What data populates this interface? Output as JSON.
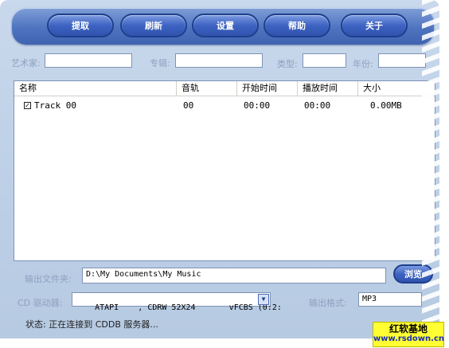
{
  "toolbar": {
    "buttons": [
      {
        "label": "提取"
      },
      {
        "label": "刷新"
      },
      {
        "label": "设置"
      },
      {
        "label": "帮助"
      },
      {
        "label": "关于"
      }
    ]
  },
  "info": {
    "artist_label": "艺术家:",
    "artist_value": "",
    "album_label": "专辑:",
    "album_value": "",
    "genre_label": "类型:",
    "genre_value": "",
    "year_label": "年份:",
    "year_value": ""
  },
  "tracklist": {
    "columns": [
      "名称",
      "音轨",
      "开始时间",
      "播放时间",
      "大小"
    ],
    "rows": [
      {
        "checked": true,
        "name": "Track 00",
        "track": "00",
        "start": "00:00",
        "duration": "00:00",
        "size": "0.00MB"
      }
    ]
  },
  "output": {
    "folder_label": "输出文件夹:",
    "folder_value": "D:\\My Documents\\My Music",
    "browse_label": "浏览",
    "drive_label": "CD 驱动器:",
    "drive_value": "ATAPI    , CDRW 52X24       vFCBS (0:2:",
    "format_label": "输出格式:",
    "format_value": "MP3"
  },
  "status": {
    "label": "状态:",
    "text": "正在连接到 CDDB 服务器..."
  },
  "watermark": {
    "line1": "红软基地",
    "line2": "www.rsdown.cn"
  }
}
